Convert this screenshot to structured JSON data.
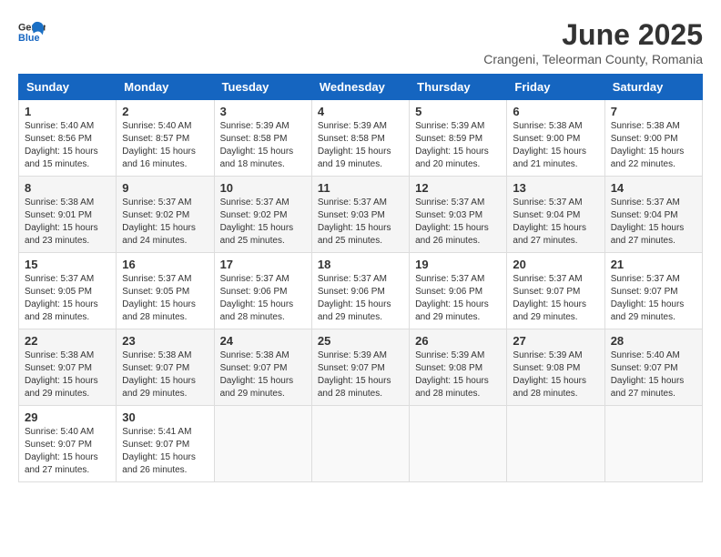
{
  "app": {
    "logo_general": "General",
    "logo_blue": "Blue",
    "month_title": "June 2025",
    "location": "Crangeni, Teleorman County, Romania"
  },
  "calendar": {
    "headers": [
      "Sunday",
      "Monday",
      "Tuesday",
      "Wednesday",
      "Thursday",
      "Friday",
      "Saturday"
    ],
    "weeks": [
      [
        null,
        {
          "day": 2,
          "sunrise": "Sunrise: 5:40 AM",
          "sunset": "Sunset: 8:57 PM",
          "daylight": "Daylight: 15 hours and 16 minutes."
        },
        {
          "day": 3,
          "sunrise": "Sunrise: 5:39 AM",
          "sunset": "Sunset: 8:58 PM",
          "daylight": "Daylight: 15 hours and 18 minutes."
        },
        {
          "day": 4,
          "sunrise": "Sunrise: 5:39 AM",
          "sunset": "Sunset: 8:58 PM",
          "daylight": "Daylight: 15 hours and 19 minutes."
        },
        {
          "day": 5,
          "sunrise": "Sunrise: 5:39 AM",
          "sunset": "Sunset: 8:59 PM",
          "daylight": "Daylight: 15 hours and 20 minutes."
        },
        {
          "day": 6,
          "sunrise": "Sunrise: 5:38 AM",
          "sunset": "Sunset: 9:00 PM",
          "daylight": "Daylight: 15 hours and 21 minutes."
        },
        {
          "day": 7,
          "sunrise": "Sunrise: 5:38 AM",
          "sunset": "Sunset: 9:00 PM",
          "daylight": "Daylight: 15 hours and 22 minutes."
        }
      ],
      [
        {
          "day": 1,
          "sunrise": "Sunrise: 5:40 AM",
          "sunset": "Sunset: 8:56 PM",
          "daylight": "Daylight: 15 hours and 15 minutes."
        },
        null,
        null,
        null,
        null,
        null,
        null
      ],
      [
        {
          "day": 8,
          "sunrise": "Sunrise: 5:38 AM",
          "sunset": "Sunset: 9:01 PM",
          "daylight": "Daylight: 15 hours and 23 minutes."
        },
        {
          "day": 9,
          "sunrise": "Sunrise: 5:37 AM",
          "sunset": "Sunset: 9:02 PM",
          "daylight": "Daylight: 15 hours and 24 minutes."
        },
        {
          "day": 10,
          "sunrise": "Sunrise: 5:37 AM",
          "sunset": "Sunset: 9:02 PM",
          "daylight": "Daylight: 15 hours and 25 minutes."
        },
        {
          "day": 11,
          "sunrise": "Sunrise: 5:37 AM",
          "sunset": "Sunset: 9:03 PM",
          "daylight": "Daylight: 15 hours and 25 minutes."
        },
        {
          "day": 12,
          "sunrise": "Sunrise: 5:37 AM",
          "sunset": "Sunset: 9:03 PM",
          "daylight": "Daylight: 15 hours and 26 minutes."
        },
        {
          "day": 13,
          "sunrise": "Sunrise: 5:37 AM",
          "sunset": "Sunset: 9:04 PM",
          "daylight": "Daylight: 15 hours and 27 minutes."
        },
        {
          "day": 14,
          "sunrise": "Sunrise: 5:37 AM",
          "sunset": "Sunset: 9:04 PM",
          "daylight": "Daylight: 15 hours and 27 minutes."
        }
      ],
      [
        {
          "day": 15,
          "sunrise": "Sunrise: 5:37 AM",
          "sunset": "Sunset: 9:05 PM",
          "daylight": "Daylight: 15 hours and 28 minutes."
        },
        {
          "day": 16,
          "sunrise": "Sunrise: 5:37 AM",
          "sunset": "Sunset: 9:05 PM",
          "daylight": "Daylight: 15 hours and 28 minutes."
        },
        {
          "day": 17,
          "sunrise": "Sunrise: 5:37 AM",
          "sunset": "Sunset: 9:06 PM",
          "daylight": "Daylight: 15 hours and 28 minutes."
        },
        {
          "day": 18,
          "sunrise": "Sunrise: 5:37 AM",
          "sunset": "Sunset: 9:06 PM",
          "daylight": "Daylight: 15 hours and 29 minutes."
        },
        {
          "day": 19,
          "sunrise": "Sunrise: 5:37 AM",
          "sunset": "Sunset: 9:06 PM",
          "daylight": "Daylight: 15 hours and 29 minutes."
        },
        {
          "day": 20,
          "sunrise": "Sunrise: 5:37 AM",
          "sunset": "Sunset: 9:07 PM",
          "daylight": "Daylight: 15 hours and 29 minutes."
        },
        {
          "day": 21,
          "sunrise": "Sunrise: 5:37 AM",
          "sunset": "Sunset: 9:07 PM",
          "daylight": "Daylight: 15 hours and 29 minutes."
        }
      ],
      [
        {
          "day": 22,
          "sunrise": "Sunrise: 5:38 AM",
          "sunset": "Sunset: 9:07 PM",
          "daylight": "Daylight: 15 hours and 29 minutes."
        },
        {
          "day": 23,
          "sunrise": "Sunrise: 5:38 AM",
          "sunset": "Sunset: 9:07 PM",
          "daylight": "Daylight: 15 hours and 29 minutes."
        },
        {
          "day": 24,
          "sunrise": "Sunrise: 5:38 AM",
          "sunset": "Sunset: 9:07 PM",
          "daylight": "Daylight: 15 hours and 29 minutes."
        },
        {
          "day": 25,
          "sunrise": "Sunrise: 5:39 AM",
          "sunset": "Sunset: 9:07 PM",
          "daylight": "Daylight: 15 hours and 28 minutes."
        },
        {
          "day": 26,
          "sunrise": "Sunrise: 5:39 AM",
          "sunset": "Sunset: 9:08 PM",
          "daylight": "Daylight: 15 hours and 28 minutes."
        },
        {
          "day": 27,
          "sunrise": "Sunrise: 5:39 AM",
          "sunset": "Sunset: 9:08 PM",
          "daylight": "Daylight: 15 hours and 28 minutes."
        },
        {
          "day": 28,
          "sunrise": "Sunrise: 5:40 AM",
          "sunset": "Sunset: 9:07 PM",
          "daylight": "Daylight: 15 hours and 27 minutes."
        }
      ],
      [
        {
          "day": 29,
          "sunrise": "Sunrise: 5:40 AM",
          "sunset": "Sunset: 9:07 PM",
          "daylight": "Daylight: 15 hours and 27 minutes."
        },
        {
          "day": 30,
          "sunrise": "Sunrise: 5:41 AM",
          "sunset": "Sunset: 9:07 PM",
          "daylight": "Daylight: 15 hours and 26 minutes."
        },
        null,
        null,
        null,
        null,
        null
      ]
    ]
  }
}
